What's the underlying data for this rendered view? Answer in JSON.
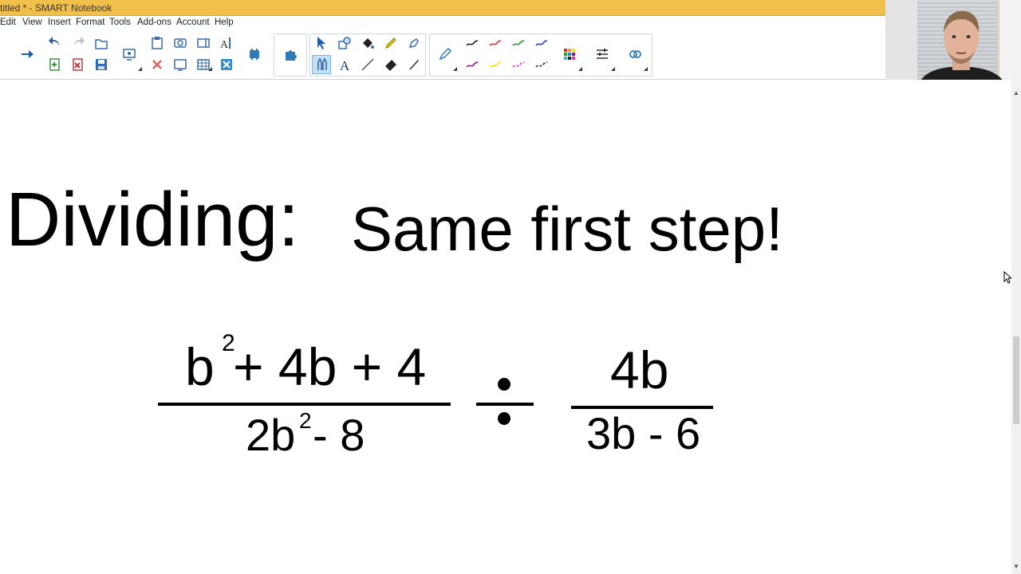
{
  "window": {
    "title": "titled * - SMART Notebook"
  },
  "menu": {
    "items": [
      "Edit",
      "View",
      "Insert",
      "Format",
      "Tools",
      "Add-ons",
      "Account",
      "Help"
    ]
  },
  "toolbar": {
    "icons": [
      "forward-arrow-icon",
      "undo-icon",
      "redo-icon",
      "paste-icon",
      "screen-shade-icon",
      "add-page-icon",
      "delete-icon",
      "save-icon",
      "record-icon",
      "table-icon",
      "properties-icon",
      "document-camera-icon",
      "select-icon",
      "pen-icon",
      "text-icon",
      "line-icon",
      "eraser-icon",
      "fill-icon",
      "creative-pen-icon",
      "color-palette-icon",
      "line-style-icon",
      "more-icon"
    ],
    "accent": "#f0c04a"
  },
  "slide": {
    "heading": "Dividing:",
    "subheading": "Same first step!",
    "left_fraction": {
      "numerator_b": "b",
      "numerator_exp": "2",
      "numerator_rest": "+ 4b + 4",
      "denominator_lead": "2b",
      "denominator_exp": "2",
      "denominator_rest": "- 8"
    },
    "right_fraction": {
      "numerator": "4b",
      "denominator": "3b - 6"
    }
  }
}
